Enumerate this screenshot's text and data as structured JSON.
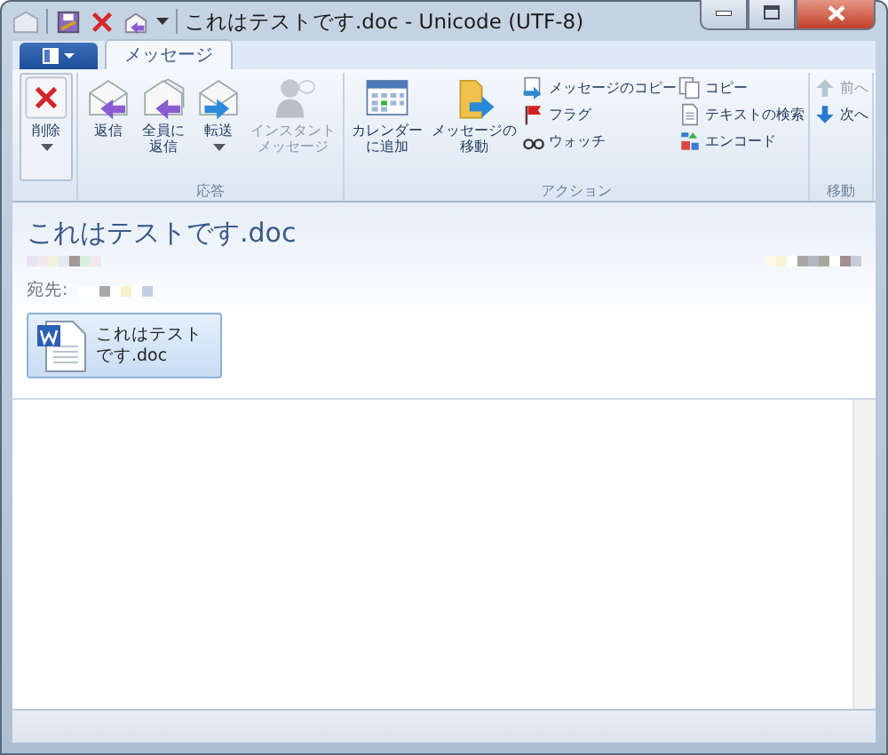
{
  "window": {
    "title": "これはテストです.doc - Unicode (UTF-8)"
  },
  "tabs": [
    {
      "label": "メッセージ",
      "selected": true
    }
  ],
  "ribbon": {
    "groups": [
      {
        "items": [
          {
            "kind": "large",
            "lines": [
              "削除"
            ],
            "dropdown": true,
            "disabled": false
          }
        ]
      },
      {
        "label": "応答",
        "items": [
          {
            "kind": "large",
            "lines": [
              "返信"
            ],
            "dropdown": false,
            "disabled": false
          },
          {
            "kind": "large",
            "lines": [
              "全員に",
              "返信"
            ],
            "dropdown": false,
            "disabled": false
          },
          {
            "kind": "large",
            "lines": [
              "転送"
            ],
            "dropdown": true,
            "disabled": false
          },
          {
            "kind": "large",
            "lines": [
              "インスタント",
              "メッセージ"
            ],
            "dropdown": false,
            "disabled": true
          }
        ]
      },
      {
        "label": "アクション",
        "items": [
          {
            "kind": "large",
            "lines": [
              "カレンダー",
              "に追加"
            ],
            "dropdown": false,
            "disabled": false
          },
          {
            "kind": "large",
            "lines": [
              "メッセージの",
              "移動"
            ],
            "dropdown": false,
            "disabled": false
          },
          {
            "kind": "column",
            "items": [
              {
                "label": "メッセージのコピー",
                "disabled": false
              },
              {
                "label": "フラグ",
                "disabled": false
              },
              {
                "label": "ウォッチ",
                "disabled": false
              }
            ]
          },
          {
            "kind": "column",
            "items": [
              {
                "label": "コピー",
                "disabled": false
              },
              {
                "label": "テキストの検索",
                "disabled": false
              },
              {
                "label": "エンコード",
                "disabled": false
              }
            ]
          }
        ]
      },
      {
        "label": "移動",
        "items": [
          {
            "kind": "column",
            "items": [
              {
                "label": "前へ",
                "disabled": true
              },
              {
                "label": "次へ",
                "disabled": false
              }
            ]
          }
        ]
      }
    ]
  },
  "message": {
    "subject": "これはテストです.doc",
    "to_label": "宛先:",
    "attachments": [
      {
        "name": "これはテストです.doc"
      }
    ]
  }
}
